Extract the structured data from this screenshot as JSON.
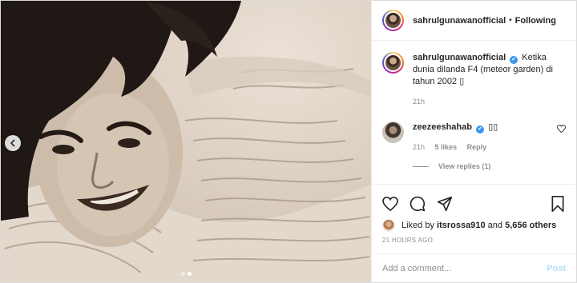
{
  "post": {
    "carousel": {
      "slide_count": 2,
      "active_slide": 2
    },
    "header": {
      "username": "sahrulgunawanofficial",
      "separator": "•",
      "follow_status": "Following"
    },
    "caption": {
      "username": "sahrulgunawanofficial",
      "verified_mark": "✔",
      "text": "Ketika dunia dilanda F4 (meteor garden) di tahun 2002 ▯",
      "time": "21h"
    },
    "comments": [
      {
        "username": "zeezeeshahab",
        "verified_mark": "✔",
        "text": "▯▯",
        "time": "21h",
        "likes": "5 likes",
        "reply_label": "Reply",
        "view_replies": "View replies (1)"
      }
    ],
    "actions": {
      "like_icon": "heart-icon",
      "comment_icon": "comment-icon",
      "share_icon": "paper-plane-icon",
      "save_icon": "bookmark-icon"
    },
    "likes": {
      "prefix": "Liked by",
      "user": "itsrossa910",
      "conjunction": "and",
      "others": "5,656 others"
    },
    "age": "21 HOURS AGO",
    "add_comment": {
      "placeholder": "Add a comment...",
      "post_label": "Post"
    },
    "colors": {
      "link": "#3897f0",
      "post_disabled": "#b2dffc",
      "muted": "#8e8e8e",
      "border": "#dbdbdb"
    }
  }
}
